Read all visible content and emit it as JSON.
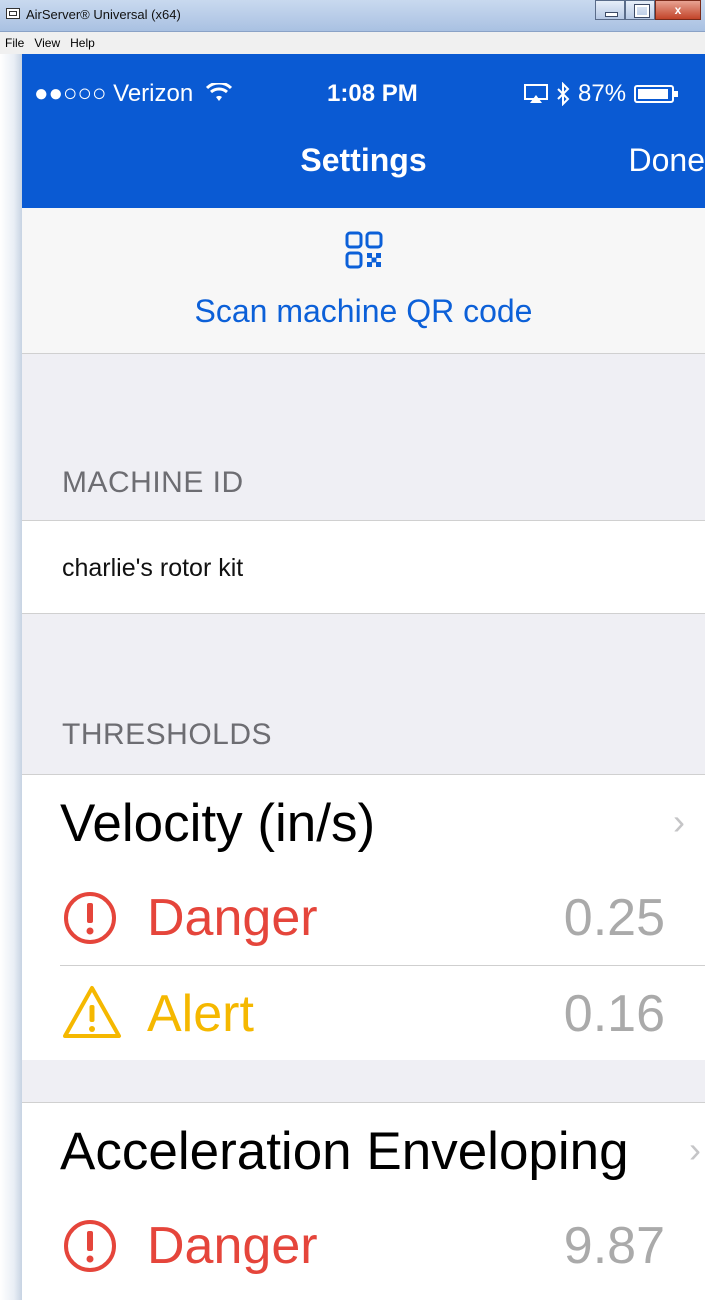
{
  "window": {
    "title": "AirServer® Universal (x64)",
    "menu": [
      "File",
      "View",
      "Help"
    ],
    "close_label": "x"
  },
  "status_bar": {
    "carrier": "●●○○○ Verizon",
    "time": "1:08 PM",
    "battery": "87%"
  },
  "nav": {
    "title": "Settings",
    "done_label": "Done"
  },
  "qr": {
    "label": "Scan machine QR code"
  },
  "machine": {
    "header": "MACHINE ID",
    "value": "charlie's rotor kit"
  },
  "thresholds": {
    "header": "THRESHOLDS",
    "groups": [
      {
        "title": "Velocity (in/s)",
        "rows": [
          {
            "level": "Danger",
            "value": "0.25"
          },
          {
            "level": "Alert",
            "value": "0.16"
          }
        ]
      },
      {
        "title": "Acceleration Enveloping",
        "rows": [
          {
            "level": "Danger",
            "value": "9.87"
          }
        ]
      }
    ]
  },
  "colors": {
    "nav_blue": "#0a5ad3",
    "link_blue": "#0c60d8",
    "danger": "#e5453b",
    "alert": "#f5b800"
  }
}
